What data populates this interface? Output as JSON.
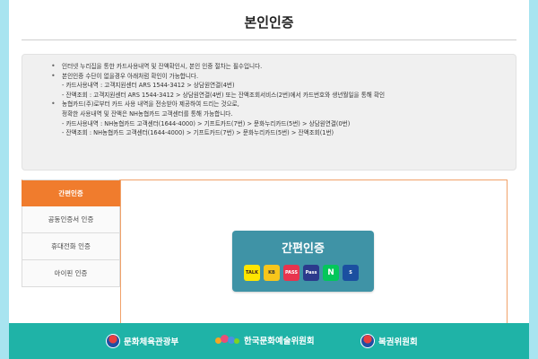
{
  "page": {
    "title": "본인인증"
  },
  "notice": {
    "lines": [
      "인터넷 누리집을 통한 카드사용내역 및 잔액확인시, 본인 인증 절차는 필수입니다.",
      "본인인증 수단이 없을경우 아래처럼 확인이 가능합니다.",
      "- 카드사용내역 : 고객지원센터 ARS 1544-3412 > 상담원연결(4번)",
      "- 잔액조회 : 고객지원센터 ARS 1544-3412 > 상담원연결(4번) 또는 잔액조회서비스(2번)에서 카드번호와 생년월일을 통해 확인",
      "농협카드(주)로부터 카드 사용 내역을 전송받아 제공하여 드리는 것으로,",
      "정확한 사용내역 및 잔액은 NH농협카드 고객센터를 통해 가능합니다.",
      "- 카드사용내역 : NH농협카드 고객센터(1644-4000) > 기프트카드(7번) > 문화누리카드(5번) > 상담원연결(0번)",
      "- 잔액조회 : NH농협카드 고객센터(1644-4000) > 기프트카드(7번) > 문화누리카드(5번) > 잔액조회(1번)"
    ]
  },
  "sidebar": {
    "items": [
      {
        "label": "간편인증"
      },
      {
        "label": "공동인증서 인증"
      },
      {
        "label": "휴대전화 인증"
      },
      {
        "label": "아이핀 인증"
      }
    ]
  },
  "auth_card": {
    "label": "간편인증",
    "icons": [
      {
        "name": "kakao-icon",
        "text": "TALK"
      },
      {
        "name": "kb-icon",
        "text": "KB"
      },
      {
        "name": "pass-icon",
        "text": "PASS"
      },
      {
        "name": "payco-icon",
        "text": "Pass"
      },
      {
        "name": "naver-icon",
        "text": "N"
      },
      {
        "name": "shinhan-icon",
        "text": "S"
      }
    ]
  },
  "footer": {
    "orgs": [
      {
        "label": "문화체육관광부"
      },
      {
        "label": "한국문화예술위원회"
      },
      {
        "label": "복권위원회"
      }
    ]
  },
  "colors": {
    "background": "#a8e4f0",
    "accent": "#f07c2d",
    "auth_card": "#3f93a6",
    "footer": "#1fb3a7"
  }
}
